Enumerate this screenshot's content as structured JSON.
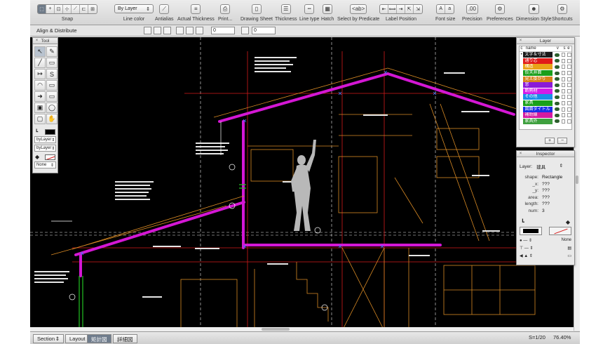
{
  "toolbar": {
    "items": [
      {
        "label": "Snap"
      },
      {
        "label": "Line color",
        "value": "By Layer"
      },
      {
        "label": "Antialias"
      },
      {
        "label": "Actual Thickness"
      },
      {
        "label": "Print..."
      },
      {
        "label": "Drawing Sheet"
      },
      {
        "label": "Thickness"
      },
      {
        "label": "Line type"
      },
      {
        "label": "Hatch"
      },
      {
        "label": "Select by Predicate"
      },
      {
        "label": "Label Position"
      },
      {
        "label": "Font size"
      },
      {
        "label": "Precision"
      },
      {
        "label": "Preferences"
      },
      {
        "label": "Dimension Style"
      },
      {
        "label": "Shortcuts"
      }
    ]
  },
  "optionbar": {
    "title": "Align & Distribute",
    "field1": "0",
    "field2": "0"
  },
  "tool_palette": {
    "title": "Tool",
    "tools": [
      "↖",
      "✎",
      "╱",
      "▭",
      "↦",
      "S",
      "◠",
      "▭",
      "➜",
      "▭",
      "▣",
      "◯",
      "▢",
      "✋"
    ],
    "sel1": "byLayer",
    "sel2": "byLayer",
    "sel3": "None"
  },
  "layer_palette": {
    "title": "Layer",
    "header": {
      "c": "c",
      "name": "name",
      "v": "v",
      "s": "s",
      "e": "e"
    },
    "layers": [
      {
        "name": "文字＆寸法",
        "color": "#1a1a1a",
        "current": true
      },
      {
        "name": "通り芯",
        "color": "#e11a1a"
      },
      {
        "name": "構造",
        "color": "#e9a318"
      },
      {
        "name": "仮天井面",
        "color": "#1a9e1a"
      },
      {
        "name": "見え掛かり",
        "color": "#d7831a"
      },
      {
        "name": "窓",
        "color": "#8a1ad7"
      },
      {
        "name": "断熱材",
        "color": "#d41ae8"
      },
      {
        "name": "その他",
        "color": "#1a8ee8"
      },
      {
        "name": "家具",
        "color": "#1aa01a"
      },
      {
        "name": "図面タイトル",
        "color": "#1a2ee8"
      },
      {
        "name": "補助線",
        "color": "#d41aa0"
      },
      {
        "name": "家具外",
        "color": "#3ea03e"
      }
    ],
    "add_label": "+",
    "remove_label": "−"
  },
  "inspector": {
    "title": "Inspector",
    "layer_label": "Layer:",
    "layer_value": "建具",
    "rows": [
      {
        "k": "shape:",
        "v": "Rectangle"
      },
      {
        "k": "_x:",
        "v": "???"
      },
      {
        "k": "_y:",
        "v": "???"
      },
      {
        "k": "area:",
        "v": "???"
      },
      {
        "k": "length:",
        "v": "???"
      },
      {
        "k": "num:",
        "v": "3"
      }
    ],
    "none_label": "None"
  },
  "bottombar": {
    "tabs": [
      {
        "label": "Section",
        "active": false
      },
      {
        "label": "Layout",
        "active": false
      },
      {
        "label": "矩計図",
        "active": true
      },
      {
        "label": "詳細図",
        "active": false
      }
    ],
    "scale": "S=1/20",
    "zoom": "76.40%"
  }
}
